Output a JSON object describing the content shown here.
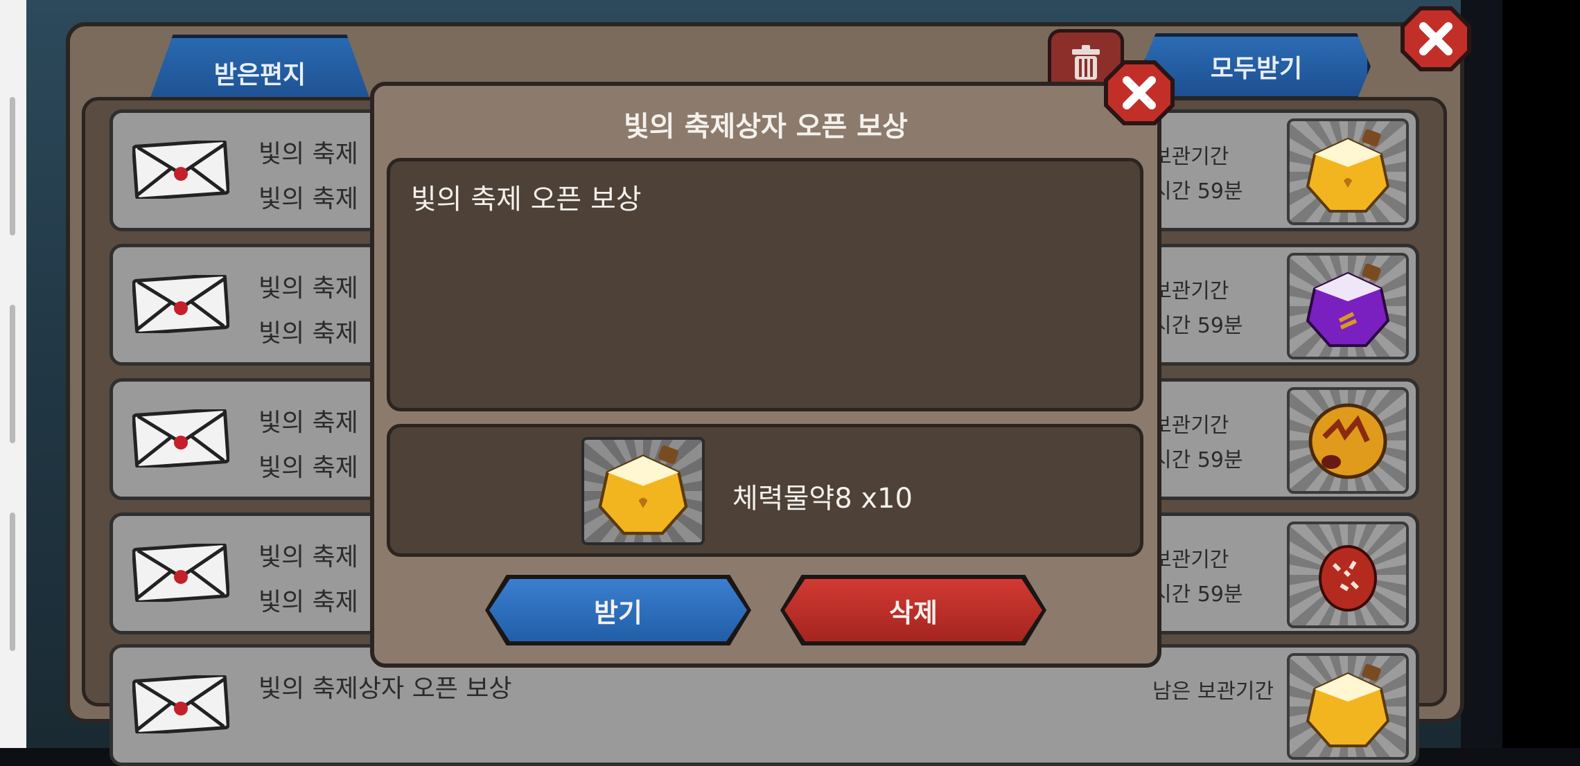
{
  "mailbox": {
    "tab_received": "받은편지",
    "receive_all": "모두받기",
    "rows": [
      {
        "line1": "빛의 축제",
        "line2": "빛의 축제",
        "right1": "보관기간",
        "right2": "시간 59분",
        "item": "yellow-potion-icon"
      },
      {
        "line1": "빛의 축제",
        "line2": "빛의 축제",
        "right1": "보관기간",
        "right2": "시간 59분",
        "item": "purple-potion-icon"
      },
      {
        "line1": "빛의 축제",
        "line2": "빛의 축제",
        "right1": "보관기간",
        "right2": "시간 59분",
        "item": "golden-egg-icon"
      },
      {
        "line1": "빛의 축제",
        "line2": "빛의 축제",
        "right1": "보관기간",
        "right2": "시간 59분",
        "item": "shell-icon"
      },
      {
        "line1": "빛의 축제상자 오픈 보상",
        "line2": "",
        "right1": "남은 보관기간",
        "right2": "",
        "item": "yellow-potion-icon"
      }
    ]
  },
  "dialog": {
    "title": "빛의 축제상자 오픈 보상",
    "message": "빛의 축제 오픈 보상",
    "reward_label": "체력물약8 x10",
    "accept_label": "받기",
    "delete_label": "삭제"
  },
  "colors": {
    "blue_button": "#2c6cb4",
    "red_button": "#c22f29",
    "panel": "#8c7b6d",
    "inner_panel": "#4d4138"
  }
}
